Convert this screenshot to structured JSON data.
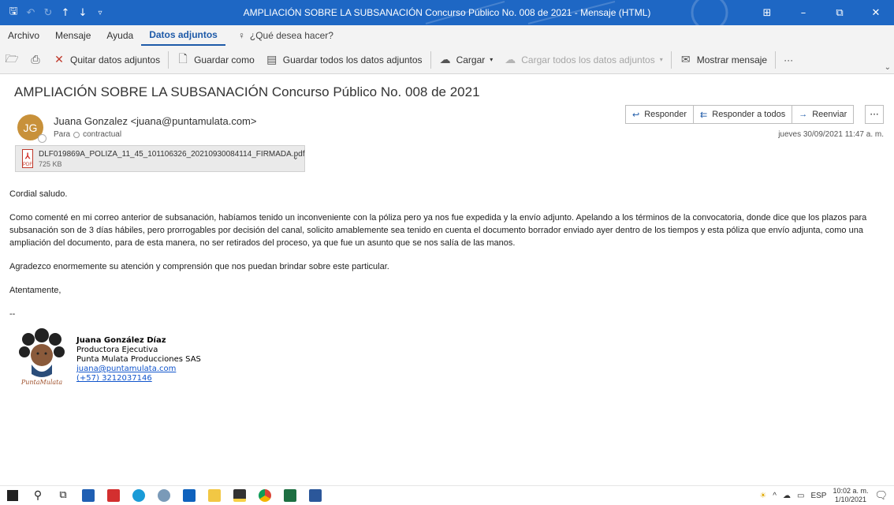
{
  "window": {
    "title": "AMPLIACIÓN SOBRE LA SUBSANACIÓN Concurso Público No. 008 de 2021  -  Mensaje (HTML)"
  },
  "menu_tabs": [
    {
      "label": "Archivo"
    },
    {
      "label": "Mensaje"
    },
    {
      "label": "Ayuda"
    },
    {
      "label": "Datos adjuntos",
      "active": true
    }
  ],
  "tell_me": "¿Qué desea hacer?",
  "ribbon": {
    "remove": "Quitar datos adjuntos",
    "save_as": "Guardar como",
    "save_all": "Guardar todos los datos adjuntos",
    "upload": "Cargar",
    "upload_all": "Cargar todos los datos adjuntos",
    "show_message": "Mostrar mensaje",
    "more": "···"
  },
  "message": {
    "subject": "AMPLIACIÓN SOBRE LA SUBSANACIÓN Concurso Público No. 008 de 2021",
    "avatar_initials": "JG",
    "avatar_color": "#c8913a",
    "from": "Juana Gonzalez <juana@puntamulata.com>",
    "to_label": "Para",
    "to": "contractual",
    "date": "jueves 30/09/2021 11:47 a. m.",
    "actions": {
      "reply": "Responder",
      "reply_all": "Responder a todos",
      "forward": "Reenviar",
      "more": "···"
    },
    "attachment": {
      "name": "DLF019869A_POLIZA_11_45_101106326_20210930084114_FIRMADA.pdf",
      "size": "725 KB",
      "type_label": "PDF"
    },
    "body": {
      "greeting": "Cordial saludo.",
      "p1": "Como comenté en mi correo anterior de subsanación, habíamos tenido un inconveniente con la póliza pero ya nos fue expedida y la envío adjunto. Apelando a los términos de la convocatoria, donde dice que los plazos para subsanación son de 3 días hábiles, pero prorrogables por decisión del canal, solicito amablemente sea tenido en cuenta el documento borrador enviado ayer dentro de los tiempos y esta póliza que envío adjunta, como una ampliación del documento, para de esta manera, no ser retirados del proceso, ya que fue un asunto que se nos salía de las manos.",
      "p2": "Agradezco enormemente su atención y comprensión que nos puedan brindar sobre este particular.",
      "closing": "Atentamente,",
      "dash": "--"
    },
    "signature": {
      "name": "Juana González Díaz",
      "role": "Productora Ejecutiva",
      "company": "Punta Mulata Producciones SAS",
      "email": "juana@puntamulata.com",
      "phone": "(+57) 3212037146",
      "logo_text": "PuntaMulata"
    }
  },
  "taskbar": {
    "lang": "ESP",
    "time": "10:02 a. m.",
    "date": "1/10/2021"
  }
}
